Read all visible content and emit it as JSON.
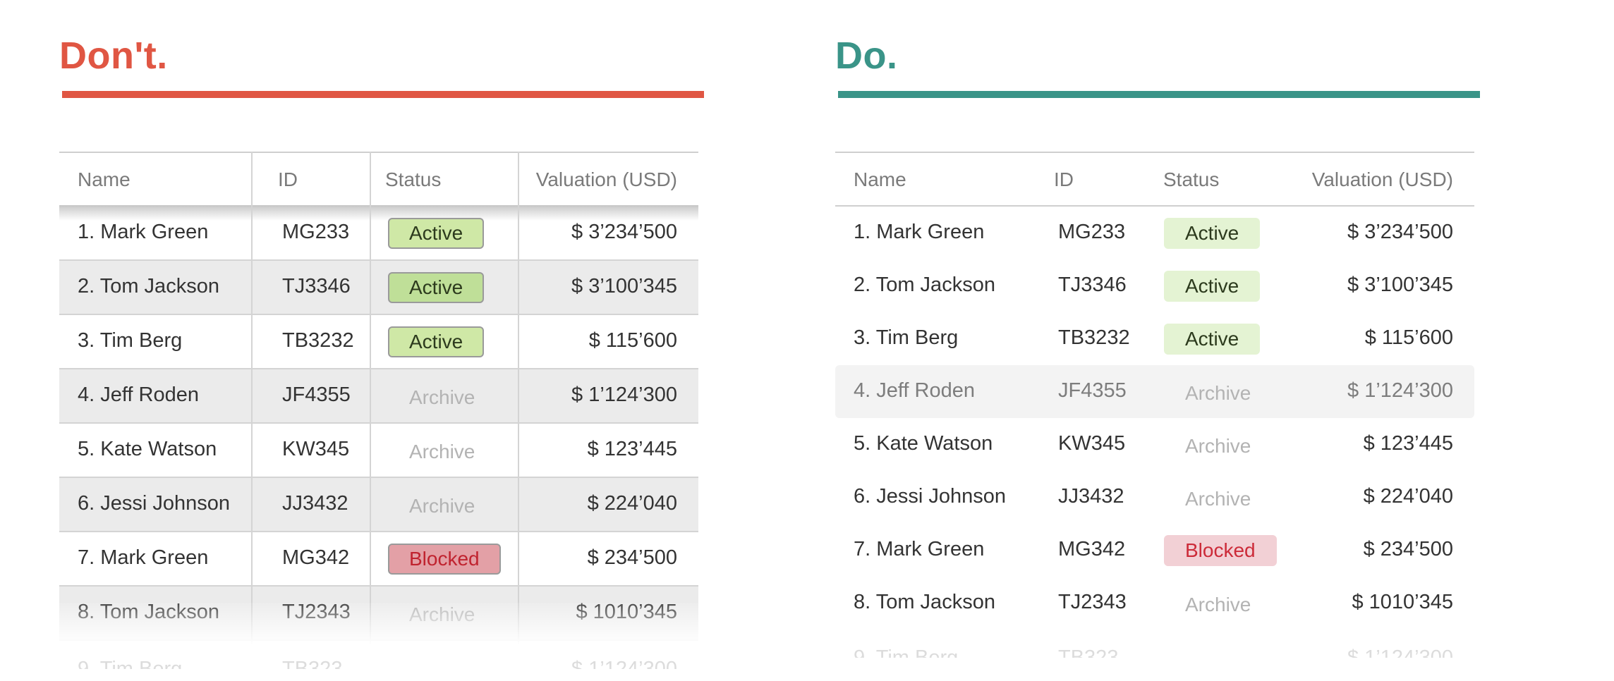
{
  "dont": {
    "heading": "Don't.",
    "columns": [
      "Name",
      "ID",
      "Status",
      "Valuation (USD)"
    ],
    "rows": [
      {
        "name": "1. Mark Green",
        "id": "MG233",
        "status": "Active",
        "valuation": "$ 3’234’500"
      },
      {
        "name": "2. Tom Jackson",
        "id": "TJ3346",
        "status": "Active",
        "valuation": "$ 3’100’345"
      },
      {
        "name": "3. Tim Berg",
        "id": "TB3232",
        "status": "Active",
        "valuation": "$ 115’600"
      },
      {
        "name": "4. Jeff Roden",
        "id": "JF4355",
        "status": "Archive",
        "valuation": "$ 1’124’300"
      },
      {
        "name": "5. Kate Watson",
        "id": "KW345",
        "status": "Archive",
        "valuation": "$ 123’445"
      },
      {
        "name": "6. Jessi Johnson",
        "id": "JJ3432",
        "status": "Archive",
        "valuation": "$ 224’040"
      },
      {
        "name": "7. Mark Green",
        "id": "MG342",
        "status": "Blocked",
        "valuation": "$ 234’500"
      },
      {
        "name": "8. Tom Jackson",
        "id": "TJ2343",
        "status": "Archive",
        "valuation": "$ 1010’345"
      }
    ],
    "ghost_row": {
      "name": "9. Tim Berg",
      "id": "TB323",
      "valuation": "$ 1’124’300"
    }
  },
  "do": {
    "heading": "Do.",
    "columns": [
      "Name",
      "ID",
      "Status",
      "Valuation (USD)"
    ],
    "rows": [
      {
        "name": "1. Mark Green",
        "id": "MG233",
        "status": "Active",
        "valuation": "$ 3’234’500"
      },
      {
        "name": "2. Tom Jackson",
        "id": "TJ3346",
        "status": "Active",
        "valuation": "$ 3’100’345"
      },
      {
        "name": "3. Tim Berg",
        "id": "TB3232",
        "status": "Active",
        "valuation": "$ 115’600"
      },
      {
        "name": "4. Jeff Roden",
        "id": "JF4355",
        "status": "Archive",
        "valuation": "$ 1’124’300"
      },
      {
        "name": "5. Kate Watson",
        "id": "KW345",
        "status": "Archive",
        "valuation": "$ 123’445"
      },
      {
        "name": "6. Jessi Johnson",
        "id": "JJ3432",
        "status": "Archive",
        "valuation": "$ 224’040"
      },
      {
        "name": "7. Mark Green",
        "id": "MG342",
        "status": "Blocked",
        "valuation": "$ 234’500"
      },
      {
        "name": "8. Tom Jackson",
        "id": "TJ2343",
        "status": "Archive",
        "valuation": "$ 1010’345"
      }
    ],
    "ghost_row": {
      "name": "9. Tim Berg",
      "id": "TB323",
      "valuation": "$ 1’124’300"
    }
  },
  "colors": {
    "dont_accent": "#e05643",
    "do_accent": "#3a9488"
  }
}
